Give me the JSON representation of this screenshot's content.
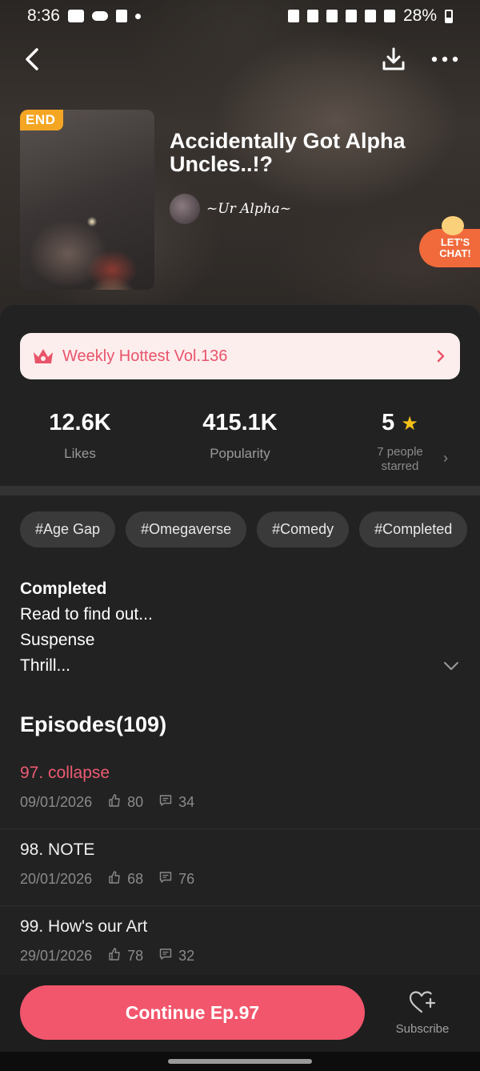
{
  "status_bar": {
    "time": "8:36",
    "battery": "28%"
  },
  "comic": {
    "badge": "END",
    "title": "Accidentally Got Alpha Uncles..!?",
    "author": "~Ur Alpha~"
  },
  "chat_bubble": {
    "line1": "LET'S",
    "line2": "CHAT!"
  },
  "weekly": {
    "label": "Weekly Hottest Vol.136"
  },
  "stats": {
    "likes_value": "12.6K",
    "likes_label": "Likes",
    "popularity_value": "415.1K",
    "popularity_label": "Popularity",
    "rating_value": "5",
    "rating_sub1": "7 people",
    "rating_sub2": "starred"
  },
  "tags": [
    "#Age Gap",
    "#Omegaverse",
    "#Comedy",
    "#Completed"
  ],
  "description": {
    "line1": "Completed",
    "line2": "Read to find out...",
    "line3": "Suspense",
    "line4": "Thrill..."
  },
  "episodes": {
    "header": "Episodes(109)",
    "items": [
      {
        "title": "97. collapse",
        "date": "09/01/2026",
        "likes": "80",
        "comments": "34"
      },
      {
        "title": "98. NOTE",
        "date": "20/01/2026",
        "likes": "68",
        "comments": "76"
      },
      {
        "title": "99. How's our Art",
        "date": "29/01/2026",
        "likes": "78",
        "comments": "32"
      }
    ]
  },
  "actions": {
    "continue_label": "Continue Ep.97",
    "subscribe_label": "Subscribe"
  },
  "colors": {
    "accent": "#f2566c",
    "badge": "#f4a623",
    "star": "#f5c01a",
    "chat": "#f06a3c"
  }
}
